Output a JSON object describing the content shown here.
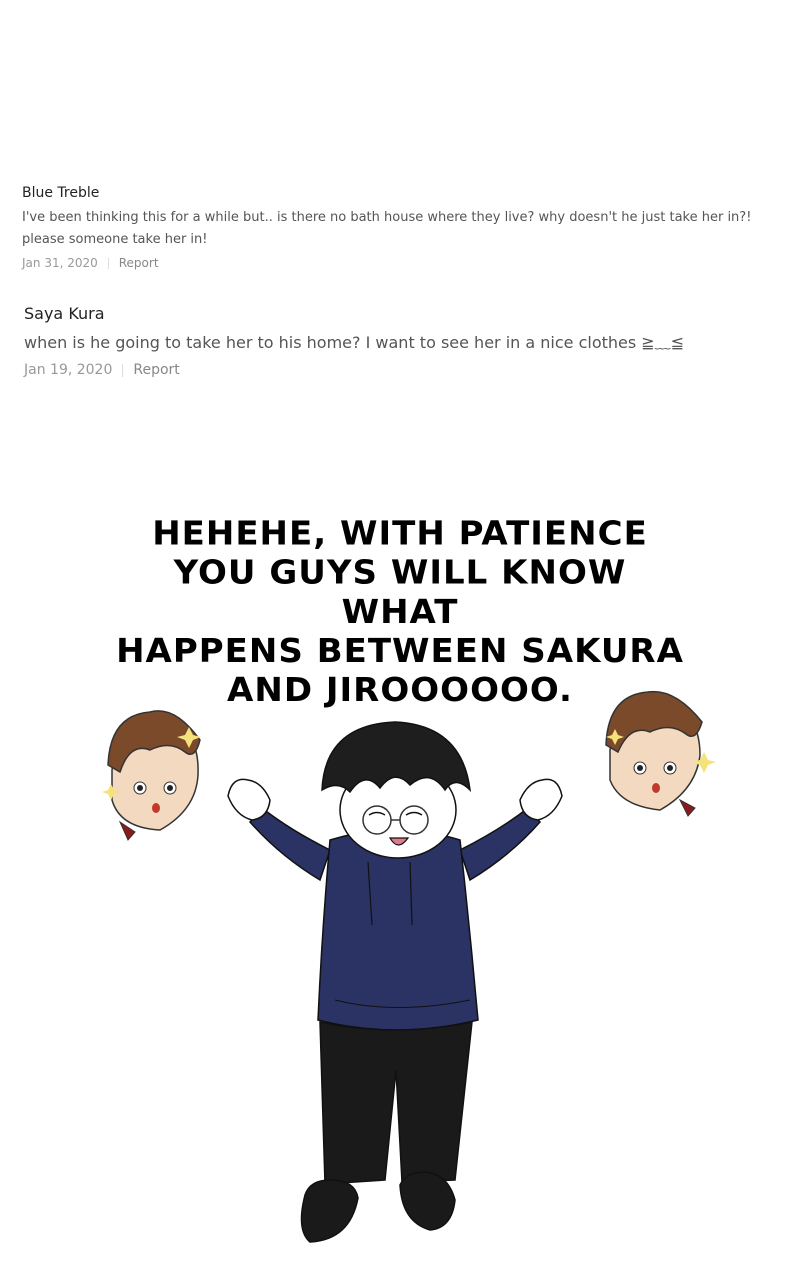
{
  "comments": [
    {
      "author": "Blue Treble",
      "text": "I've been thinking this for a while but.. is there no bath house where they live? why doesn't he just take her in?! please someone take her in!",
      "date": "Jan 31, 2020",
      "report_label": "Report"
    },
    {
      "author": "Saya Kura",
      "text": "when is he going to take her to his home? I want to see her in a nice clothes ≧﹏≦",
      "date": "Jan 19, 2020",
      "report_label": "Report"
    }
  ],
  "caption": {
    "lines": [
      "HEHEHE, WITH PATIENCE",
      "YOU GUYS WILL KNOW WHAT",
      "HAPPENS BETWEEN SAKURA",
      "AND JIROOOOOO."
    ]
  },
  "colors": {
    "hoodie": "#2a3363",
    "pants": "#1a1a1a",
    "hair": "#1e1e1e",
    "chibi_hair": "#7a4a2a"
  }
}
